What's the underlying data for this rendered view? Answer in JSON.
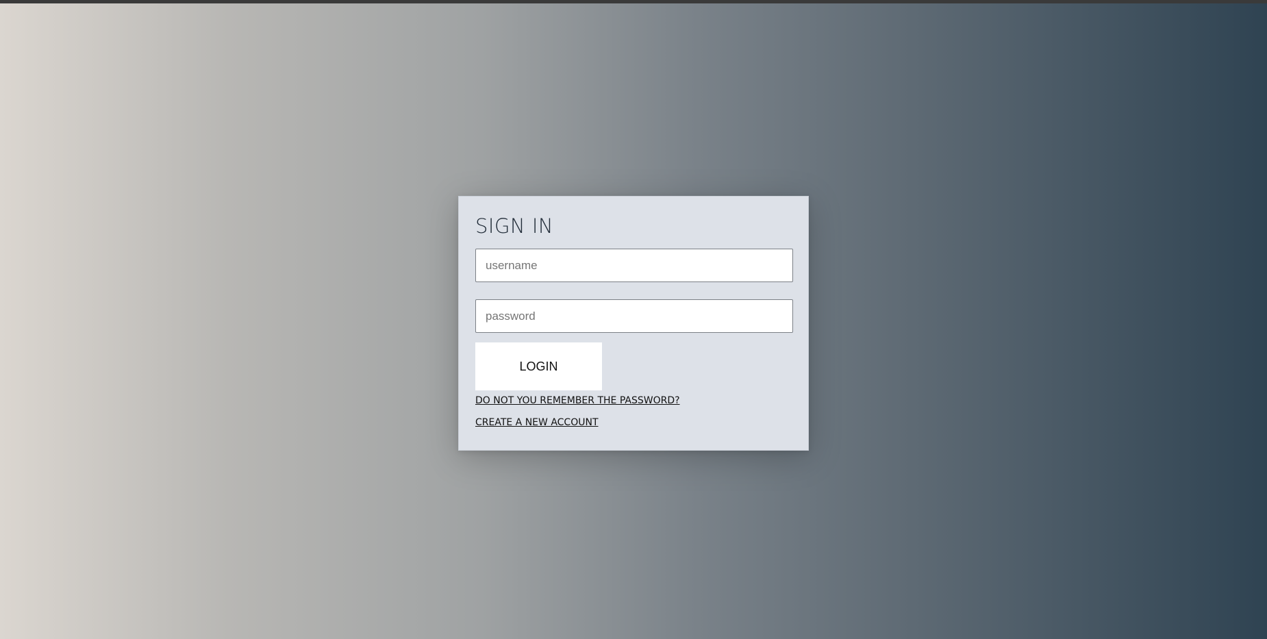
{
  "login": {
    "title": "SIGN IN",
    "username_placeholder": "username",
    "password_placeholder": "password",
    "button_label": "LOGIN",
    "forgot_password_link": "DO NOT YOU REMEMBER THE PASSWORD?",
    "create_account_link": "CREATE A NEW ACCOUNT"
  },
  "colors": {
    "card_background": "#dde1e8",
    "gradient_left": "#dbd6d0",
    "gradient_right": "#2f4352",
    "button_background": "#ffffff"
  }
}
